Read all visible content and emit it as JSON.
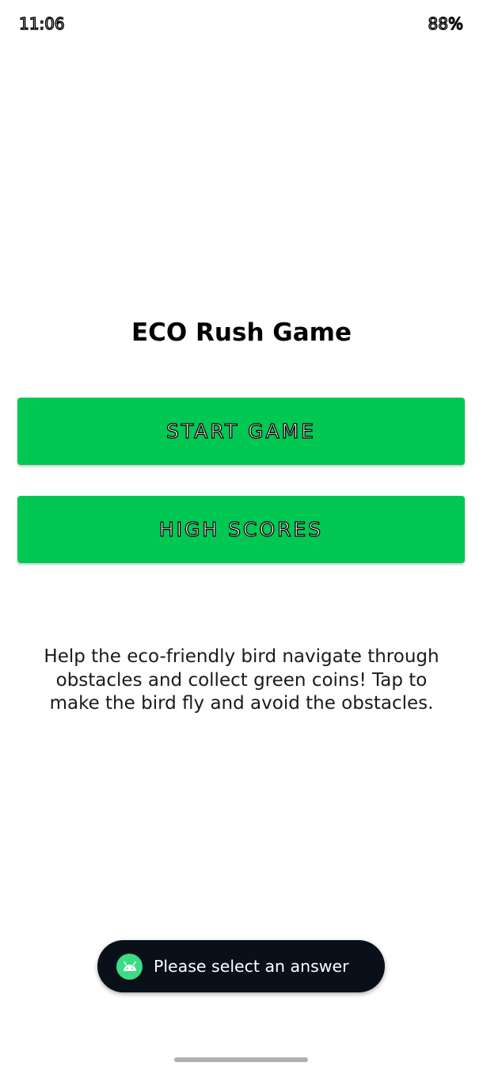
{
  "status_bar": {
    "time": "11:06",
    "battery": "88%"
  },
  "main": {
    "title": "ECO Rush Game",
    "start_button": "START GAME",
    "high_scores_button": "HIGH SCORES",
    "description": "Help the eco-friendly bird navigate through obstacles and collect green coins! Tap to make the bird fly and avoid the obstacles."
  },
  "toast": {
    "icon": "android-icon",
    "message": "Please select an answer"
  },
  "colors": {
    "accent_green": "#00c853",
    "toast_background": "#0a101a",
    "android_green": "#3ddc84"
  }
}
